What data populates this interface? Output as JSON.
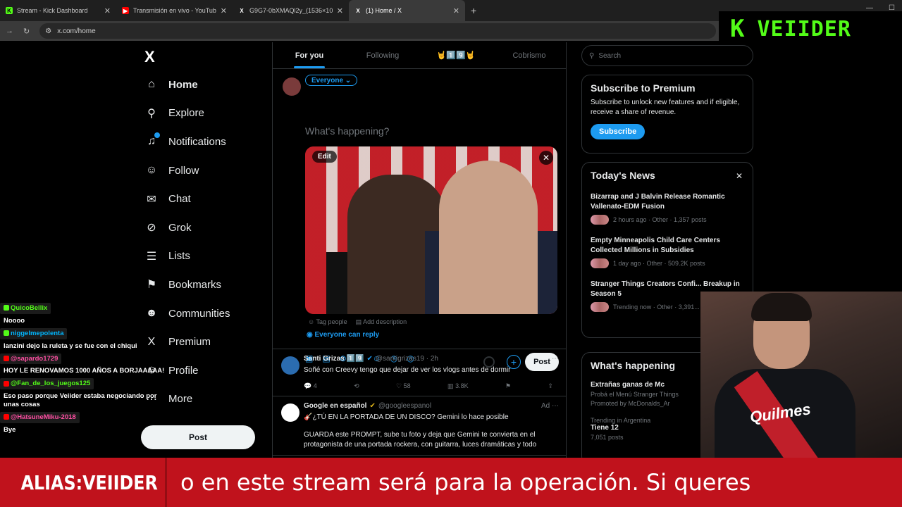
{
  "browser": {
    "tabs": [
      {
        "label": "Stream - Kick Dashboard",
        "fav_color": "#53fc18",
        "fav": "K",
        "active": false
      },
      {
        "label": "Transmisión en vivo - YouTube",
        "fav_color": "#ff0000",
        "fav": "▶",
        "active": false
      },
      {
        "label": "G9G7-0bXMAQl2y_(1536×10...",
        "fav_color": "#000000",
        "fav": "X",
        "active": false
      },
      {
        "label": "(1) Home / X",
        "fav_color": "#000000",
        "fav": "X",
        "active": true
      }
    ],
    "url": "x.com/home"
  },
  "overlay": {
    "logo_k": "K",
    "logo_name": "VEIIDER"
  },
  "nav": {
    "logo": "X",
    "items": [
      {
        "label": "Home",
        "icon": "home-icon",
        "glyph": "⌂"
      },
      {
        "label": "Explore",
        "icon": "search-icon",
        "glyph": "⚲"
      },
      {
        "label": "Notifications",
        "icon": "bell-icon",
        "glyph": "🔔"
      },
      {
        "label": "Follow",
        "icon": "follow-icon",
        "glyph": "👤"
      },
      {
        "label": "Chat",
        "icon": "mail-icon",
        "glyph": "✉"
      },
      {
        "label": "Grok",
        "icon": "grok-icon",
        "glyph": "⊘"
      },
      {
        "label": "Lists",
        "icon": "list-icon",
        "glyph": "☰"
      },
      {
        "label": "Bookmarks",
        "icon": "bookmark-icon",
        "glyph": "🔖"
      },
      {
        "label": "Communities",
        "icon": "communities-icon",
        "glyph": "👥"
      },
      {
        "label": "Premium",
        "icon": "x-premium-icon",
        "glyph": "X"
      },
      {
        "label": "Profile",
        "icon": "profile-icon",
        "glyph": "👤"
      },
      {
        "label": "More",
        "icon": "more-icon",
        "glyph": "⋯"
      }
    ],
    "post_label": "Post"
  },
  "center": {
    "tabs": [
      "For you",
      "Following",
      "🤘1️⃣9️⃣🤘",
      "Cobrismo"
    ],
    "compose": {
      "audience": "Everyone ⌄",
      "placeholder": "What's happening?",
      "edit": "Edit",
      "tag_people": "Tag people",
      "add_description": "Add description",
      "can_reply": "Everyone can reply",
      "post": "Post"
    },
    "tweets": [
      {
        "name": "Santi Grizas 1️⃣9️⃣",
        "handle": "@santigrizas19 · 2h",
        "text": "Soñé con Creevy tengo que dejar de ver los vlogs antes de dormir",
        "replies": "4",
        "retweets": "",
        "likes": "58",
        "views": "3.8K"
      },
      {
        "name": "Google en español",
        "handle": "@googleespanol",
        "ad": "Ad",
        "text": "🎸¿TÚ EN LA PORTADA DE UN DISCO? Gemini lo hace posible",
        "text2": "GUARDA este PROMPT, sube tu foto y deja que Gemini te convierta en el protagonista de una portada rockera, con guitarra, luces dramáticas y todo"
      }
    ]
  },
  "right": {
    "search_placeholder": "Search",
    "premium": {
      "title": "Subscribe to Premium",
      "text": "Subscribe to unlock new features and if eligible, receive a share of revenue.",
      "button": "Subscribe"
    },
    "news": {
      "title": "Today's News",
      "items": [
        {
          "headline": "Bizarrap and J Balvin Release Romantic Vallenato-EDM Fusion",
          "meta": "2 hours ago · Other · 1,357 posts"
        },
        {
          "headline": "Empty Minneapolis Child Care Centers Collected Millions in Subsidies",
          "meta": "1 day ago · Other · 509.2K posts"
        },
        {
          "headline": "Stranger Things Creators Confi... Breakup in Season 5",
          "meta": "Trending now · Other · 3,391..."
        }
      ]
    },
    "happening": {
      "title": "What's happening",
      "items": [
        {
          "headline": "Extrañas ganas de Mc",
          "sub": "Probá el Menú Stranger Things",
          "meta": "Promoted by McDonalds_Ar"
        },
        {
          "pre": "Trending in Argentina",
          "headline": "Tiene 12",
          "meta": "7,051 posts"
        }
      ]
    }
  },
  "chat": [
    {
      "user": "QuicoBellix",
      "color": "#53fc18",
      "text": "Noooo"
    },
    {
      "user": "niggelmepolenta",
      "color": "#00b7ff",
      "text": "lanzini dejo la ruleta y se fue con el chiqui"
    },
    {
      "user": "@sapardo1729",
      "color": "#ff4fa3",
      "text": "HOY LE RENOVAMOS 1000 AÑOS A BORJAAAAA!"
    },
    {
      "user": "@Fan_de_los_juegos125",
      "color": "#53fc18",
      "text": "Eso paso porque Veiider estaba negociando por unas cosas"
    },
    {
      "user": "@HatsuneMiku-2018",
      "color": "#ff4fa3",
      "text": "Bye"
    }
  ],
  "ticker": {
    "alias": "ALIAS:VEIIDER",
    "message": "o en este stream será para la operación.         Si queres"
  },
  "webcam": {
    "jersey_text": "Quilmes"
  }
}
